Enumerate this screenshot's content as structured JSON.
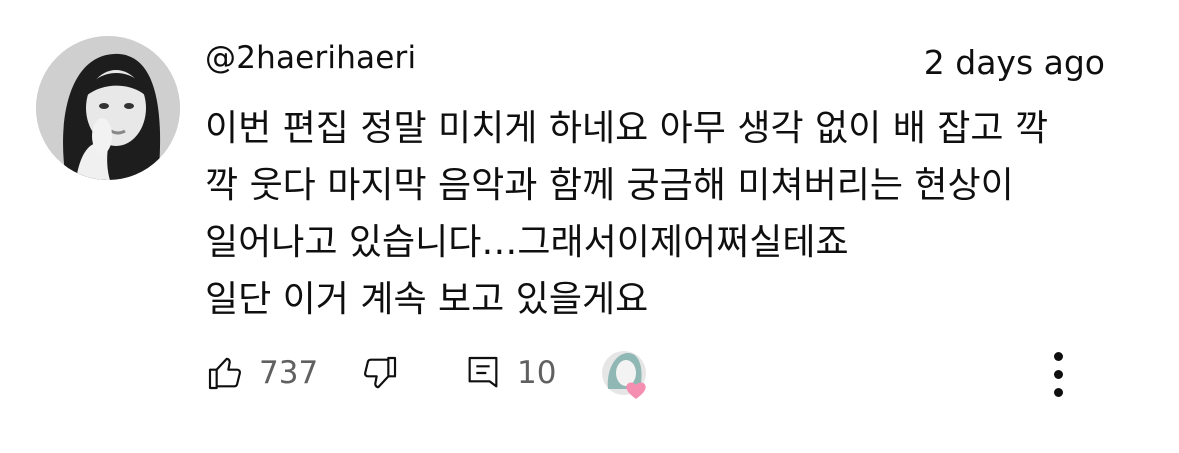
{
  "comment": {
    "author_handle": "@2haerihaeri",
    "timestamp": "2 days ago",
    "text_lines": [
      "이번 편집 정말 미치게 하네요 아무 생각 없이 배 잡고 깍",
      "깍 웃다 마지막 음악과 함께 궁금해 미쳐버리는 현상이",
      "일어나고 있습니다…그래서이제어쩌실테죠",
      "일단 이거 계속 보고 있을게요"
    ]
  },
  "actions": {
    "like_count": "737",
    "reply_count": "10",
    "like_icon": "thumbs-up-icon",
    "dislike_icon": "thumbs-down-icon",
    "reply_icon": "comment-icon",
    "creator_heart_icon": "creator-heart-icon",
    "menu_icon": "more-vertical-icon"
  },
  "colors": {
    "text": "#0f0f0f",
    "secondary_text": "#606060",
    "heart": "#f48fb1",
    "background": "#ffffff"
  }
}
